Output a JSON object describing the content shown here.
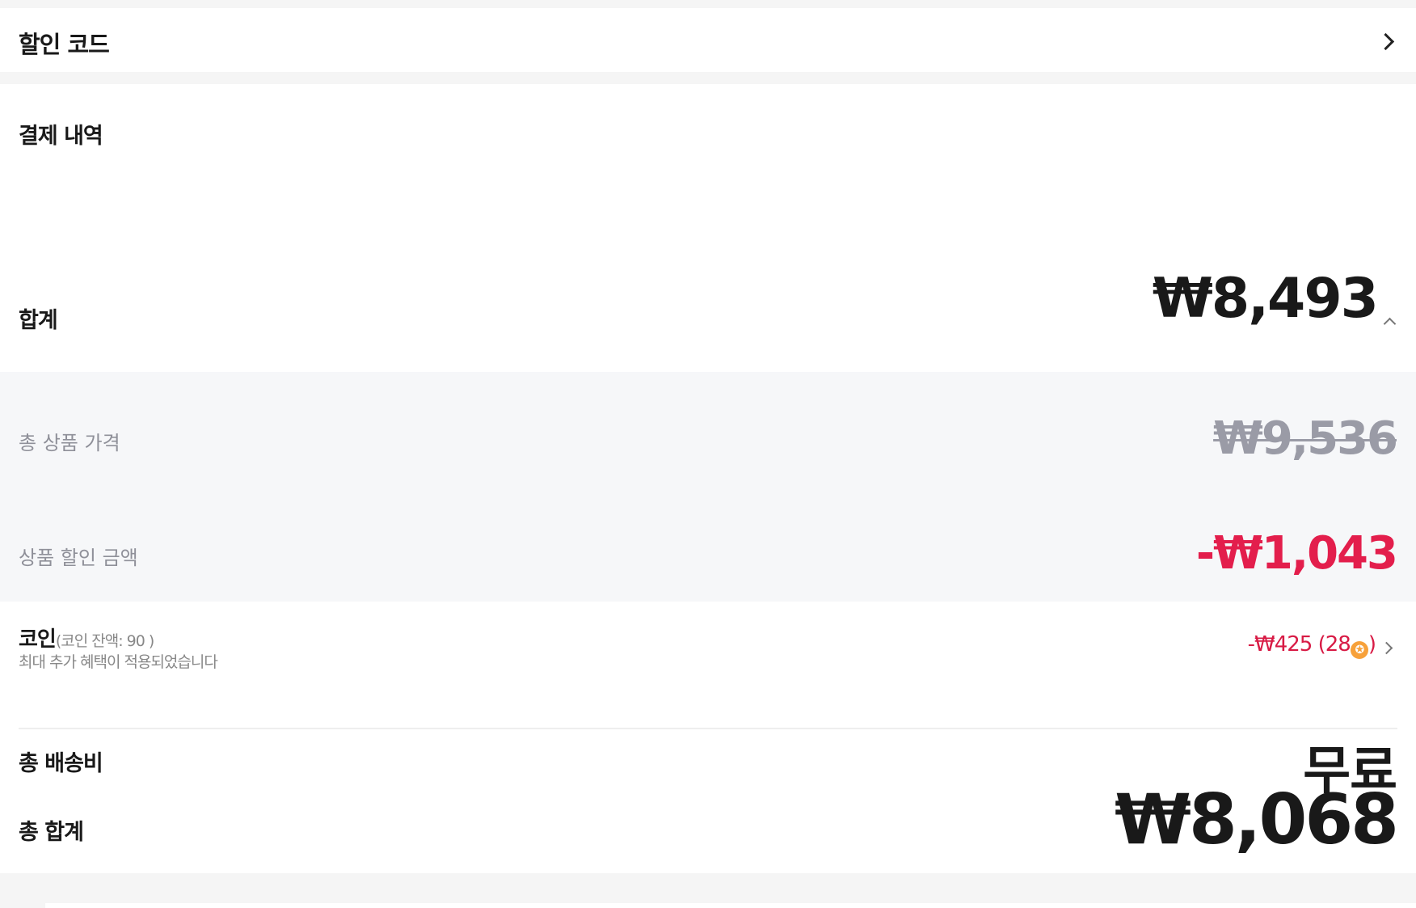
{
  "discount_code": {
    "label": "할인 코드"
  },
  "payment": {
    "title": "결제 내역",
    "subtotal": {
      "label": "합계",
      "value": "₩8,493"
    },
    "product_price": {
      "label": "총 상품 가격",
      "value": "₩9,536"
    },
    "product_discount": {
      "label": "상품 할인 금액",
      "value": "-₩1,043"
    },
    "coin": {
      "label": "코인",
      "balance_text": "(코인 잔액: 90 )",
      "note": "최대 추가 혜택이 적용되었습니다",
      "value_prefix": "-₩425 (28",
      "value_suffix": ")",
      "coin_glyph": "✪"
    },
    "shipping": {
      "label": "총 배송비",
      "value": "무료"
    },
    "total": {
      "label": "총 합계",
      "value": "₩8,068"
    }
  },
  "icons": [
    "chevron-right-icon",
    "chevron-up-icon",
    "coin-icon"
  ],
  "colors": {
    "background": "#f5f5f5",
    "card": "#ffffff",
    "breakdown_bg": "#f6f7f9",
    "muted_text": "#8f9099",
    "discount_red": "#e31e4c",
    "coin_orange": "#f7a13a"
  }
}
